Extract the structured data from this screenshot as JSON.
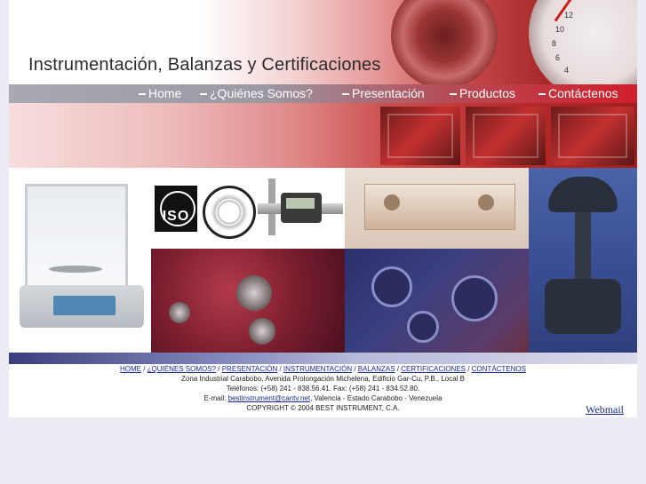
{
  "header": {
    "title": "Instrumentación, Balanzas y Certificaciones",
    "gauge_ticks": [
      "12",
      "10",
      "8",
      "6",
      "4"
    ]
  },
  "nav": {
    "items": [
      {
        "label": "Home"
      },
      {
        "label": "¿Quiénes Somos?"
      },
      {
        "label": "Presentación"
      },
      {
        "label": "Productos"
      },
      {
        "label": "Contáctenos"
      }
    ]
  },
  "logos": {
    "iso_text": "ISO"
  },
  "footer": {
    "links": [
      {
        "label": "HOME"
      },
      {
        "label": "¿QUIÉNES SOMOS?"
      },
      {
        "label": "PRESENTACIÓN"
      },
      {
        "label": "INSTRUMENTACIÓN"
      },
      {
        "label": "BALANZAS"
      },
      {
        "label": "CERTIFICACIONES"
      },
      {
        "label": "CONTÁCTENOS"
      }
    ],
    "address": "Zona Industrial Carabobo, Avenida Prolongación Michelena, Edificio Gar-Cu, P.B., Local B",
    "phones": "Teléfonos: (+58) 241 - 838.56.41. Fax: (+58) 241 - 834.52.80.",
    "email_prefix": "E-mail: ",
    "email": "bestinstrument@cantv.net",
    "email_suffix": ", Valencia - Estado Carabobo - Venezuela",
    "copyright": "COPYRIGHT © 2004 BEST INSTRUMENT, C.A."
  },
  "webmail_label": "Webmail",
  "colors": {
    "nav_red": "#d01e2a",
    "link_blue": "#1a2a9a",
    "valve_blue": "#3a4f94"
  }
}
